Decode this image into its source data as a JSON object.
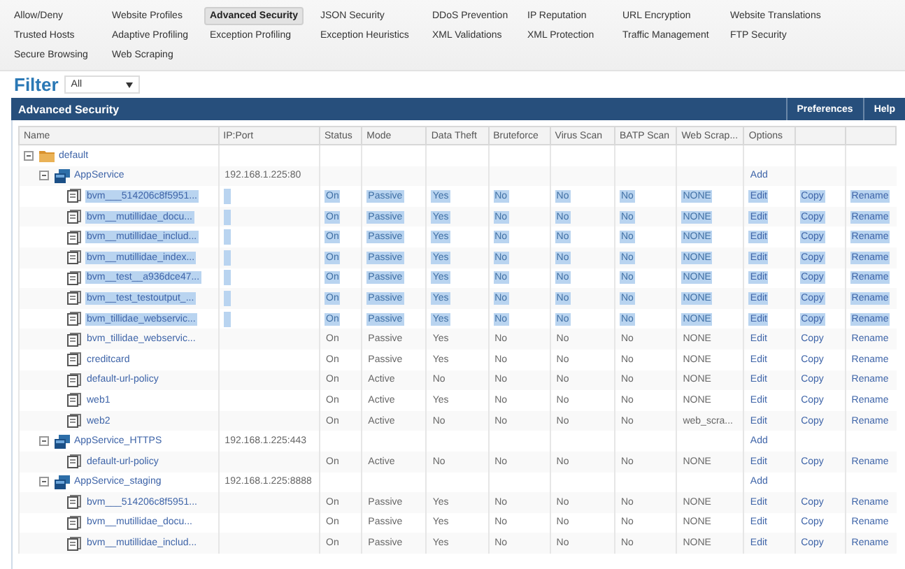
{
  "nav": {
    "rows": [
      [
        {
          "label": "Allow/Deny",
          "selected": false
        },
        {
          "label": "Website Profiles",
          "selected": false
        },
        {
          "label": "Advanced Security",
          "selected": true
        },
        {
          "label": "JSON Security",
          "selected": false
        },
        {
          "label": "DDoS Prevention",
          "selected": false
        },
        {
          "label": "IP Reputation",
          "selected": false
        },
        {
          "label": "URL Encryption",
          "selected": false
        },
        {
          "label": "Website Translations",
          "selected": false
        }
      ],
      [
        {
          "label": "Trusted Hosts",
          "selected": false
        },
        {
          "label": "Adaptive Profiling",
          "selected": false
        },
        {
          "label": "Exception Profiling",
          "selected": false
        },
        {
          "label": "Exception Heuristics",
          "selected": false
        },
        {
          "label": "XML Validations",
          "selected": false
        },
        {
          "label": "XML Protection",
          "selected": false
        },
        {
          "label": "Traffic Management",
          "selected": false
        },
        {
          "label": "FTP Security",
          "selected": false
        }
      ],
      [
        {
          "label": "Secure Browsing",
          "selected": false
        },
        {
          "label": "Web Scraping",
          "selected": false
        }
      ]
    ]
  },
  "filter": {
    "label": "Filter",
    "value": "All"
  },
  "panel": {
    "title": "Advanced Security",
    "buttons": [
      "Preferences",
      "Help"
    ]
  },
  "table": {
    "columns": [
      "Name",
      "IP:Port",
      "Status",
      "Mode",
      "Data Theft",
      "Bruteforce",
      "Virus Scan",
      "BATP Scan",
      "Web Scrap...",
      "Options"
    ],
    "tree": [
      {
        "kind": "folder",
        "name": "default",
        "expanded": true,
        "children": [
          {
            "kind": "service",
            "name": "AppService",
            "ip_port": "192.168.1.225:80",
            "expanded": true,
            "actions": [
              "Add"
            ],
            "children": [
              {
                "kind": "policy",
                "name": "bvm___514206c8f5951...",
                "selected": true,
                "cells": [
                  "On",
                  "Passive",
                  "Yes",
                  "No",
                  "No",
                  "No",
                  "NONE"
                ],
                "actions": [
                  "Edit",
                  "Copy",
                  "Rename"
                ]
              },
              {
                "kind": "policy",
                "name": "bvm__mutillidae_docu...",
                "selected": true,
                "cells": [
                  "On",
                  "Passive",
                  "Yes",
                  "No",
                  "No",
                  "No",
                  "NONE"
                ],
                "actions": [
                  "Edit",
                  "Copy",
                  "Rename"
                ]
              },
              {
                "kind": "policy",
                "name": "bvm__mutillidae_includ...",
                "selected": true,
                "cells": [
                  "On",
                  "Passive",
                  "Yes",
                  "No",
                  "No",
                  "No",
                  "NONE"
                ],
                "actions": [
                  "Edit",
                  "Copy",
                  "Rename"
                ]
              },
              {
                "kind": "policy",
                "name": "bvm__mutillidae_index...",
                "selected": true,
                "cells": [
                  "On",
                  "Passive",
                  "Yes",
                  "No",
                  "No",
                  "No",
                  "NONE"
                ],
                "actions": [
                  "Edit",
                  "Copy",
                  "Rename"
                ]
              },
              {
                "kind": "policy",
                "name": "bvm__test__a936dce47...",
                "selected": true,
                "cells": [
                  "On",
                  "Passive",
                  "Yes",
                  "No",
                  "No",
                  "No",
                  "NONE"
                ],
                "actions": [
                  "Edit",
                  "Copy",
                  "Rename"
                ]
              },
              {
                "kind": "policy",
                "name": "bvm__test_testoutput_...",
                "selected": true,
                "cells": [
                  "On",
                  "Passive",
                  "Yes",
                  "No",
                  "No",
                  "No",
                  "NONE"
                ],
                "actions": [
                  "Edit",
                  "Copy",
                  "Rename"
                ]
              },
              {
                "kind": "policy",
                "name": "bvm_tillidae_webservic...",
                "selected": true,
                "cells": [
                  "On",
                  "Passive",
                  "Yes",
                  "No",
                  "No",
                  "No",
                  "NONE"
                ],
                "actions": [
                  "Edit",
                  "Copy",
                  "Rename"
                ]
              },
              {
                "kind": "policy",
                "name": "bvm_tillidae_webservic...",
                "selected": false,
                "cells": [
                  "On",
                  "Passive",
                  "Yes",
                  "No",
                  "No",
                  "No",
                  "NONE"
                ],
                "actions": [
                  "Edit",
                  "Copy",
                  "Rename"
                ]
              },
              {
                "kind": "policy",
                "name": "creditcard",
                "selected": false,
                "cells": [
                  "On",
                  "Passive",
                  "Yes",
                  "No",
                  "No",
                  "No",
                  "NONE"
                ],
                "actions": [
                  "Edit",
                  "Copy",
                  "Rename"
                ]
              },
              {
                "kind": "policy",
                "name": "default-url-policy",
                "selected": false,
                "cells": [
                  "On",
                  "Active",
                  "No",
                  "No",
                  "No",
                  "No",
                  "NONE"
                ],
                "actions": [
                  "Edit",
                  "Copy",
                  "Rename"
                ]
              },
              {
                "kind": "policy",
                "name": "web1",
                "selected": false,
                "cells": [
                  "On",
                  "Active",
                  "Yes",
                  "No",
                  "No",
                  "No",
                  "NONE"
                ],
                "actions": [
                  "Edit",
                  "Copy",
                  "Rename"
                ]
              },
              {
                "kind": "policy",
                "name": "web2",
                "selected": false,
                "cells": [
                  "On",
                  "Active",
                  "No",
                  "No",
                  "No",
                  "No",
                  "web_scra..."
                ],
                "actions": [
                  "Edit",
                  "Copy",
                  "Rename"
                ]
              }
            ]
          },
          {
            "kind": "service",
            "name": "AppService_HTTPS",
            "ip_port": "192.168.1.225:443",
            "expanded": true,
            "actions": [
              "Add"
            ],
            "children": [
              {
                "kind": "policy",
                "name": "default-url-policy",
                "selected": false,
                "cells": [
                  "On",
                  "Active",
                  "No",
                  "No",
                  "No",
                  "No",
                  "NONE"
                ],
                "actions": [
                  "Edit",
                  "Copy",
                  "Rename"
                ]
              }
            ]
          },
          {
            "kind": "service",
            "name": "AppService_staging",
            "ip_port": "192.168.1.225:8888",
            "expanded": true,
            "actions": [
              "Add"
            ],
            "children": [
              {
                "kind": "policy",
                "name": "bvm___514206c8f5951...",
                "selected": false,
                "cells": [
                  "On",
                  "Passive",
                  "Yes",
                  "No",
                  "No",
                  "No",
                  "NONE"
                ],
                "actions": [
                  "Edit",
                  "Copy",
                  "Rename"
                ]
              },
              {
                "kind": "policy",
                "name": "bvm__mutillidae_docu...",
                "selected": false,
                "cells": [
                  "On",
                  "Passive",
                  "Yes",
                  "No",
                  "No",
                  "No",
                  "NONE"
                ],
                "actions": [
                  "Edit",
                  "Copy",
                  "Rename"
                ]
              },
              {
                "kind": "policy",
                "name": "bvm__mutillidae_includ...",
                "selected": false,
                "cells": [
                  "On",
                  "Passive",
                  "Yes",
                  "No",
                  "No",
                  "No",
                  "NONE"
                ],
                "actions": [
                  "Edit",
                  "Copy",
                  "Rename"
                ]
              }
            ]
          }
        ]
      }
    ]
  }
}
